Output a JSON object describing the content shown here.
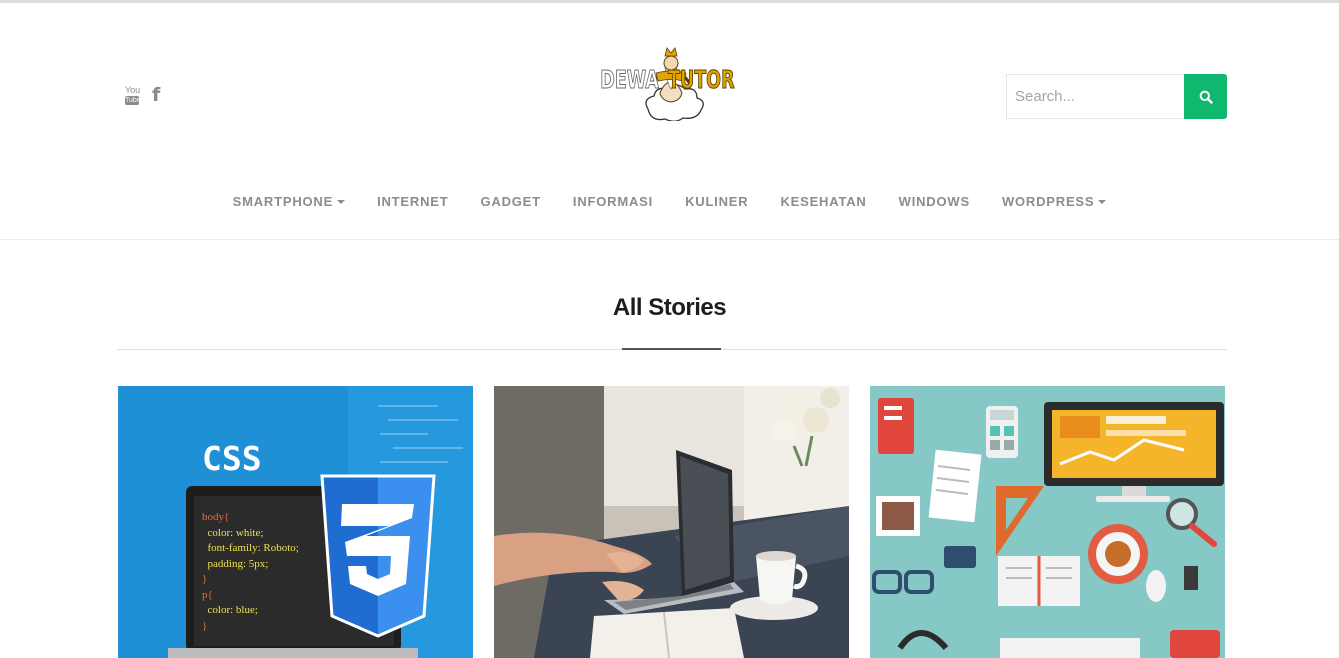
{
  "social": {
    "youtube_top": "You",
    "youtube_bottom": "Tube",
    "facebook": "f"
  },
  "logo": {
    "left_word": "DEWA",
    "right_word": "TUTOR"
  },
  "search": {
    "placeholder": "Search..."
  },
  "nav": {
    "items": [
      {
        "label": "SMARTPHONE",
        "dropdown": true
      },
      {
        "label": "INTERNET",
        "dropdown": false
      },
      {
        "label": "GADGET",
        "dropdown": false
      },
      {
        "label": "INFORMASI",
        "dropdown": false
      },
      {
        "label": "KULINER",
        "dropdown": false
      },
      {
        "label": "KESEHATAN",
        "dropdown": false
      },
      {
        "label": "WINDOWS",
        "dropdown": false
      },
      {
        "label": "WORDPRESS",
        "dropdown": true
      }
    ]
  },
  "section": {
    "title": "All Stories"
  },
  "cards": {
    "c1": {
      "badge": "CSS",
      "code": [
        "body{",
        "  color: white;",
        "  font-family: Roboto;",
        "  padding: 5px;",
        "}",
        "p{",
        "  color: blue;",
        "}"
      ]
    }
  },
  "colors": {
    "accent": "#10b76e",
    "nav_text": "#8c8c8c",
    "heading": "#1d1d1d"
  }
}
